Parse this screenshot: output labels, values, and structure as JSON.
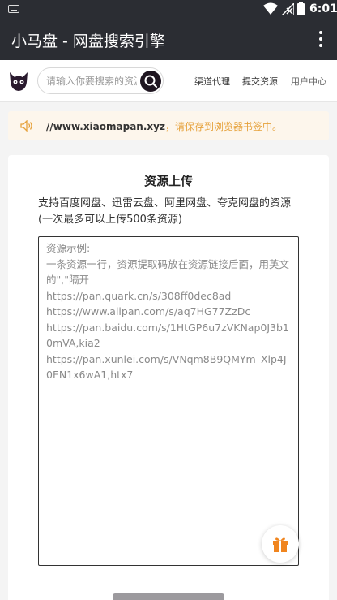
{
  "status_bar": {
    "time": "6:01"
  },
  "app_bar": {
    "title": "小马盘 - 网盘搜索引擎"
  },
  "header": {
    "search_placeholder": "请输入你要搜索的资源",
    "nav": [
      "渠道代理",
      "提交资源",
      "用户中心"
    ]
  },
  "notice": {
    "url": "//www.xiaomapan.xyz",
    "message": "，请保存到浏览器书签中。"
  },
  "upload": {
    "title": "资源上传",
    "description": "支持百度网盘、迅雷云盘、阿里网盘、夸克网盘的资源(一次最多可以上传500条资源)",
    "textarea_placeholder": "资源示例:\n一条资源一行，资源提取码放在资源链接后面，用英文的\",\"隔开\nhttps://pan.quark.cn/s/308ff0dec8ad\nhttps://www.alipan.com/s/aq7HG77ZzDc\nhttps://pan.baidu.com/s/1HtGP6u7zVKNap0J3b10mVA,kia2\nhttps://pan.xunlei.com/s/VNqm8B9QMYm_Xlp4J0EN1x6wA1,htx7"
  },
  "colors": {
    "appbar": "#2b2d33",
    "notice_bg": "#fdf6ec",
    "notice_text": "#e6a23c",
    "gift": "#f0851f"
  },
  "icons": [
    "keyboard-icon",
    "wifi-icon",
    "no-signal-icon",
    "battery-icon",
    "more-vert-icon",
    "logo-icon",
    "search-icon",
    "speaker-icon",
    "gift-icon"
  ]
}
